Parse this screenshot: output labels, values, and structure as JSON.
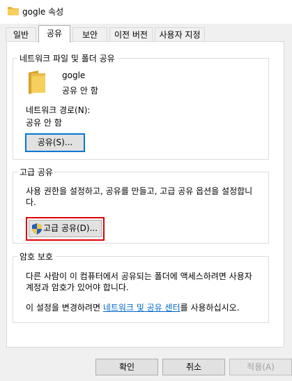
{
  "window": {
    "title": "gogle 속성"
  },
  "tabs": [
    {
      "label": "일반"
    },
    {
      "label": "공유"
    },
    {
      "label": "보안"
    },
    {
      "label": "이전 버전"
    },
    {
      "label": "사용자 지정"
    }
  ],
  "active_tab": "공유",
  "network_share": {
    "group_title": "네트워크 파일 및 폴더 공유",
    "folder_name": "gogle",
    "status": "공유 안 함",
    "path_label": "네트워크 경로(N):",
    "path_value": "공유 안 함",
    "share_button": "공유(S)..."
  },
  "advanced_share": {
    "group_title": "고급 공유",
    "description_line1": "사용 권한을 설정하고, 공유를 만들고, 고급 공유 옵션을 설정합니",
    "description_line2": "다.",
    "button": "고급 공유(D)..."
  },
  "password_protection": {
    "group_title": "암호 보호",
    "line1": "다른 사람이 이 컴퓨터에서 공유되는 폴더에 액세스하려면 사용자",
    "line2": "계정과 암호가 있어야 합니다.",
    "line3_prefix": "이 설정을 변경하려면 ",
    "link_text": "네트워크 및 공유 센터",
    "line3_suffix": "를 사용하십시오."
  },
  "footer": {
    "ok": "확인",
    "cancel": "취소",
    "apply": "적용(A)"
  },
  "colors": {
    "highlight_border": "#e00000",
    "link": "#0066cc",
    "folder": "#f2c34a"
  },
  "icons": {
    "title": "folder-icon",
    "folder": "folder-icon",
    "advanced_share_button": "shield-icon"
  }
}
